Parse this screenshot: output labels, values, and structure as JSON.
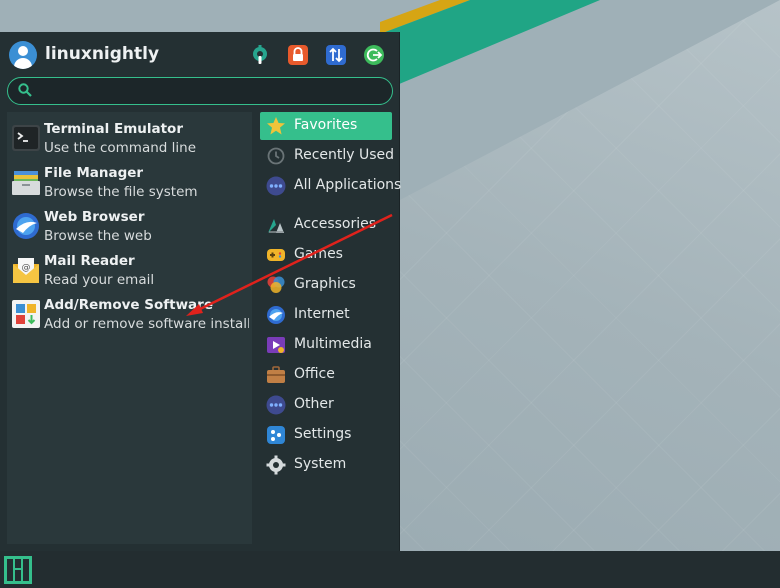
{
  "user": {
    "name": "linuxnightly"
  },
  "header_actions": [
    {
      "name": "settings",
      "color": "#26a58e"
    },
    {
      "name": "lock-screen",
      "color": "#e85a2c"
    },
    {
      "name": "switch-user",
      "color": "#2f6bd0"
    },
    {
      "name": "log-out",
      "color": "#3dbb5c"
    }
  ],
  "search": {
    "value": "",
    "placeholder": ""
  },
  "favorites": [
    {
      "title": "Terminal Emulator",
      "desc": "Use the command line",
      "icon": "terminal-icon"
    },
    {
      "title": "File Manager",
      "desc": "Browse the file system",
      "icon": "file-manager-icon"
    },
    {
      "title": "Web Browser",
      "desc": "Browse the web",
      "icon": "web-browser-icon"
    },
    {
      "title": "Mail Reader",
      "desc": "Read your email",
      "icon": "mail-icon"
    },
    {
      "title": "Add/Remove Software",
      "desc": "Add or remove software install...",
      "icon": "software-icon"
    }
  ],
  "categories": [
    {
      "label": "Favorites",
      "icon": "star-icon",
      "active": true
    },
    {
      "label": "Recently Used",
      "icon": "clock-icon"
    },
    {
      "label": "All Applications",
      "icon": "dots-icon"
    },
    {
      "label": "Accessories",
      "icon": "accessories-icon"
    },
    {
      "label": "Games",
      "icon": "gamepad-icon"
    },
    {
      "label": "Graphics",
      "icon": "graphics-icon"
    },
    {
      "label": "Internet",
      "icon": "internet-icon"
    },
    {
      "label": "Multimedia",
      "icon": "multimedia-icon"
    },
    {
      "label": "Office",
      "icon": "office-icon"
    },
    {
      "label": "Other",
      "icon": "other-icon"
    },
    {
      "label": "Settings",
      "icon": "settings-icon"
    },
    {
      "label": "System",
      "icon": "system-icon"
    }
  ],
  "colors": {
    "accent": "#35bf8c",
    "menu_bg": "#243033",
    "pane_bg": "#2a383b",
    "annotation": "#e0221c"
  }
}
